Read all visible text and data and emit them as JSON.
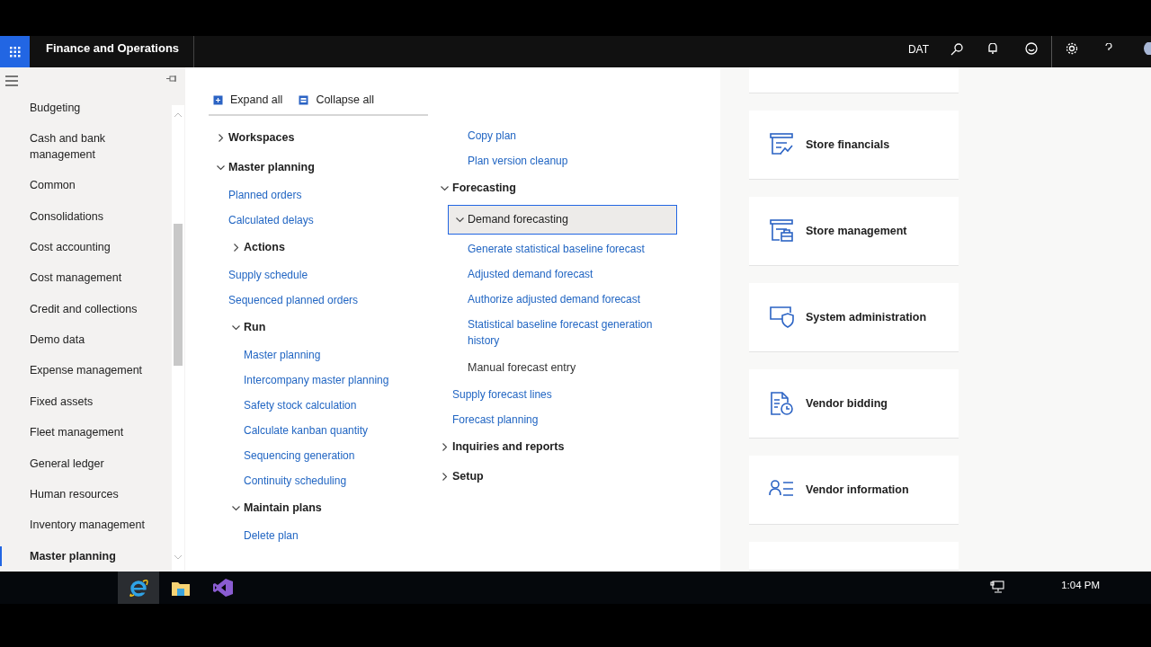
{
  "header": {
    "title": "Finance and Operations",
    "company": "DAT"
  },
  "sidebar": {
    "items": [
      {
        "label": "Budgeting",
        "selected": false
      },
      {
        "label": "Cash and bank management",
        "selected": false
      },
      {
        "label": "Common",
        "selected": false
      },
      {
        "label": "Consolidations",
        "selected": false
      },
      {
        "label": "Cost accounting",
        "selected": false
      },
      {
        "label": "Cost management",
        "selected": false
      },
      {
        "label": "Credit and collections",
        "selected": false
      },
      {
        "label": "Demo data",
        "selected": false
      },
      {
        "label": "Expense management",
        "selected": false
      },
      {
        "label": "Fixed assets",
        "selected": false
      },
      {
        "label": "Fleet management",
        "selected": false
      },
      {
        "label": "General ledger",
        "selected": false
      },
      {
        "label": "Human resources",
        "selected": false
      },
      {
        "label": "Inventory management",
        "selected": false
      },
      {
        "label": "Master planning",
        "selected": true
      }
    ]
  },
  "toolbar": {
    "expand_all": "Expand all",
    "collapse_all": "Collapse all"
  },
  "menu": {
    "column_1": [
      {
        "kind": "group",
        "label": "Workspaces",
        "expanded": false,
        "selected": false
      },
      {
        "kind": "group",
        "label": "Master planning",
        "expanded": true,
        "selected": false,
        "children": [
          {
            "kind": "link",
            "label": "Planned orders",
            "selected": false
          },
          {
            "kind": "link",
            "label": "Calculated delays",
            "selected": false
          },
          {
            "kind": "group",
            "label": "Actions",
            "expanded": false,
            "selected": false
          },
          {
            "kind": "link",
            "label": "Supply schedule",
            "selected": false
          },
          {
            "kind": "link",
            "label": "Sequenced planned orders",
            "selected": false
          },
          {
            "kind": "group",
            "label": "Run",
            "expanded": true,
            "selected": false,
            "children": [
              {
                "kind": "link",
                "label": "Master planning",
                "selected": false
              },
              {
                "kind": "link",
                "label": "Intercompany master planning",
                "selected": false
              },
              {
                "kind": "link",
                "label": "Safety stock calculation",
                "selected": false
              },
              {
                "kind": "link",
                "label": "Calculate kanban quantity",
                "selected": false
              },
              {
                "kind": "link",
                "label": "Sequencing generation",
                "selected": false
              },
              {
                "kind": "link",
                "label": "Continuity scheduling",
                "selected": false
              }
            ]
          },
          {
            "kind": "group",
            "label": "Maintain plans",
            "expanded": true,
            "selected": false,
            "children": [
              {
                "kind": "link",
                "label": "Delete plan",
                "selected": false
              }
            ]
          }
        ]
      }
    ],
    "column_2": [
      {
        "kind": "continuation",
        "children": [
          {
            "kind": "continuation",
            "children": [
              {
                "kind": "link",
                "label": "Copy plan",
                "selected": false
              },
              {
                "kind": "link",
                "label": "Plan version cleanup",
                "selected": false
              }
            ]
          }
        ]
      },
      {
        "kind": "group",
        "label": "Forecasting",
        "expanded": true,
        "selected": false,
        "children": [
          {
            "kind": "group",
            "label": "Demand forecasting",
            "expanded": true,
            "selected": true,
            "children": [
              {
                "kind": "link",
                "label": "Generate statistical baseline forecast",
                "selected": false
              },
              {
                "kind": "link",
                "label": "Adjusted demand forecast",
                "selected": false
              },
              {
                "kind": "link",
                "label": "Authorize adjusted demand forecast",
                "selected": false
              },
              {
                "kind": "link",
                "label": "Statistical baseline forecast generation history",
                "selected": false
              },
              {
                "kind": "heading",
                "label": "Manual forecast entry",
                "selected": false
              }
            ]
          },
          {
            "kind": "link",
            "label": "Supply forecast lines",
            "selected": false
          },
          {
            "kind": "link",
            "label": "Forecast planning",
            "selected": false
          }
        ]
      },
      {
        "kind": "group",
        "label": "Inquiries and reports",
        "expanded": false,
        "selected": false
      },
      {
        "kind": "group",
        "label": "Setup",
        "expanded": false,
        "selected": false
      }
    ]
  },
  "tiles": [
    {
      "kind": "partial"
    },
    {
      "kind": "tile",
      "label": "Store financials"
    },
    {
      "kind": "tile",
      "label": "Store management"
    },
    {
      "kind": "tile",
      "label": "System administration"
    },
    {
      "kind": "tile",
      "label": "Vendor bidding"
    },
    {
      "kind": "tile",
      "label": "Vendor information"
    },
    {
      "kind": "partial"
    }
  ],
  "taskbar": {
    "time": "1:04 PM"
  }
}
